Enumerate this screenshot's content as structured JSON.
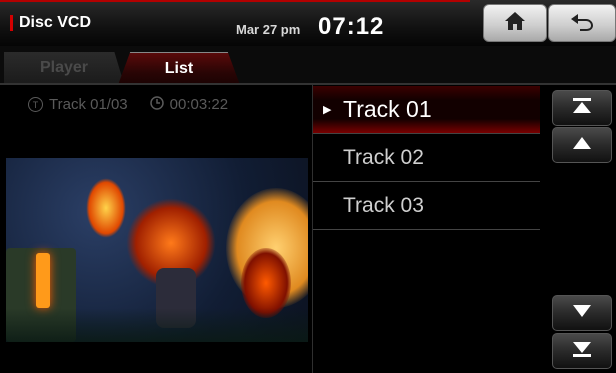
{
  "header": {
    "title": "Disc VCD",
    "date": "Mar 27 pm",
    "time": "07:12"
  },
  "tabs": [
    {
      "label": "Player",
      "active": false
    },
    {
      "label": "List",
      "active": true
    }
  ],
  "info": {
    "track": "Track 01/03",
    "elapsed": "00:03:22"
  },
  "tracks": [
    {
      "label": "Track 01",
      "playing": true
    },
    {
      "label": "Track 02",
      "playing": false
    },
    {
      "label": "Track 03",
      "playing": false
    }
  ],
  "icons": {
    "home": "home-icon",
    "back": "back-arrow-icon",
    "top": "scroll-top-icon",
    "up": "scroll-up-icon",
    "down": "scroll-down-icon",
    "bottom": "scroll-bottom-icon"
  },
  "colors": {
    "accent": "#b30000",
    "background": "#000000"
  }
}
